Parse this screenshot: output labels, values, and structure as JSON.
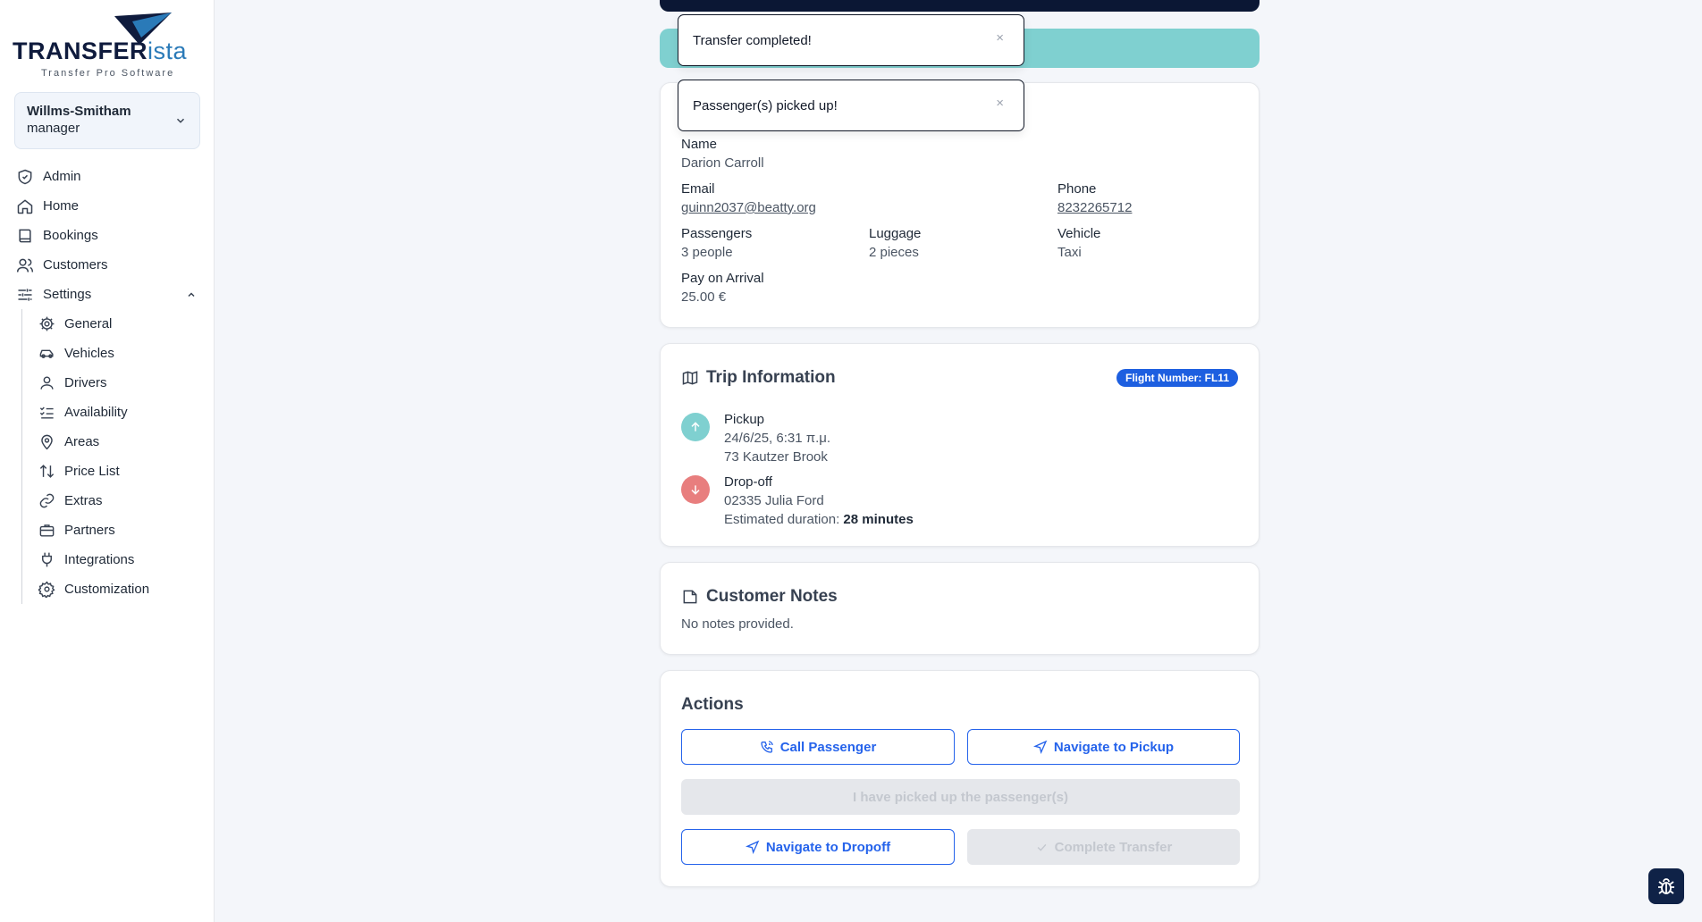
{
  "brand": {
    "name_part1": "TRANSFER",
    "name_part2": "ista",
    "tagline": "Transfer Pro Software"
  },
  "org": {
    "name": "Willms-Smitham",
    "role": "manager"
  },
  "nav": {
    "admin": "Admin",
    "home": "Home",
    "bookings": "Bookings",
    "customers": "Customers",
    "settings": "Settings",
    "sub": {
      "general": "General",
      "vehicles": "Vehicles",
      "drivers": "Drivers",
      "availability": "Availability",
      "areas": "Areas",
      "price_list": "Price List",
      "extras": "Extras",
      "partners": "Partners",
      "integrations": "Integrations",
      "customization": "Customization"
    }
  },
  "toasts": {
    "first": "Transfer completed!",
    "second": "Passenger(s) picked up!",
    "close": "×"
  },
  "customer": {
    "name_label": "Name",
    "name": "Darion Carroll",
    "email_label": "Email",
    "email": "guinn2037@beatty.org",
    "phone_label": "Phone",
    "phone": "8232265712",
    "passengers_label": "Passengers",
    "passengers": "3 people",
    "luggage_label": "Luggage",
    "luggage": "2 pieces",
    "vehicle_label": "Vehicle",
    "vehicle": "Taxi",
    "pay_label": "Pay on Arrival",
    "pay": "25.00 €"
  },
  "trip": {
    "title": "Trip Information",
    "flight_badge": "Flight Number: FL11",
    "pickup_label": "Pickup",
    "pickup_time": "24/6/25, 6:31 π.μ.",
    "pickup_address": "73 Kautzer Brook",
    "dropoff_label": "Drop-off",
    "dropoff_address": "02335 Julia Ford",
    "duration_label": "Estimated duration:",
    "duration": "28 minutes"
  },
  "notes": {
    "title": "Customer Notes",
    "text": "No notes provided."
  },
  "actions": {
    "title": "Actions",
    "call": "Call Passenger",
    "nav_pickup": "Navigate to Pickup",
    "picked_up": "I have picked up the passenger(s)",
    "nav_dropoff": "Navigate to Dropoff",
    "complete": "Complete Transfer"
  },
  "colors": {
    "primary": "#2563eb",
    "teal": "#7fd0d0",
    "danger": "#e87e7e",
    "navy": "#0b1734"
  }
}
